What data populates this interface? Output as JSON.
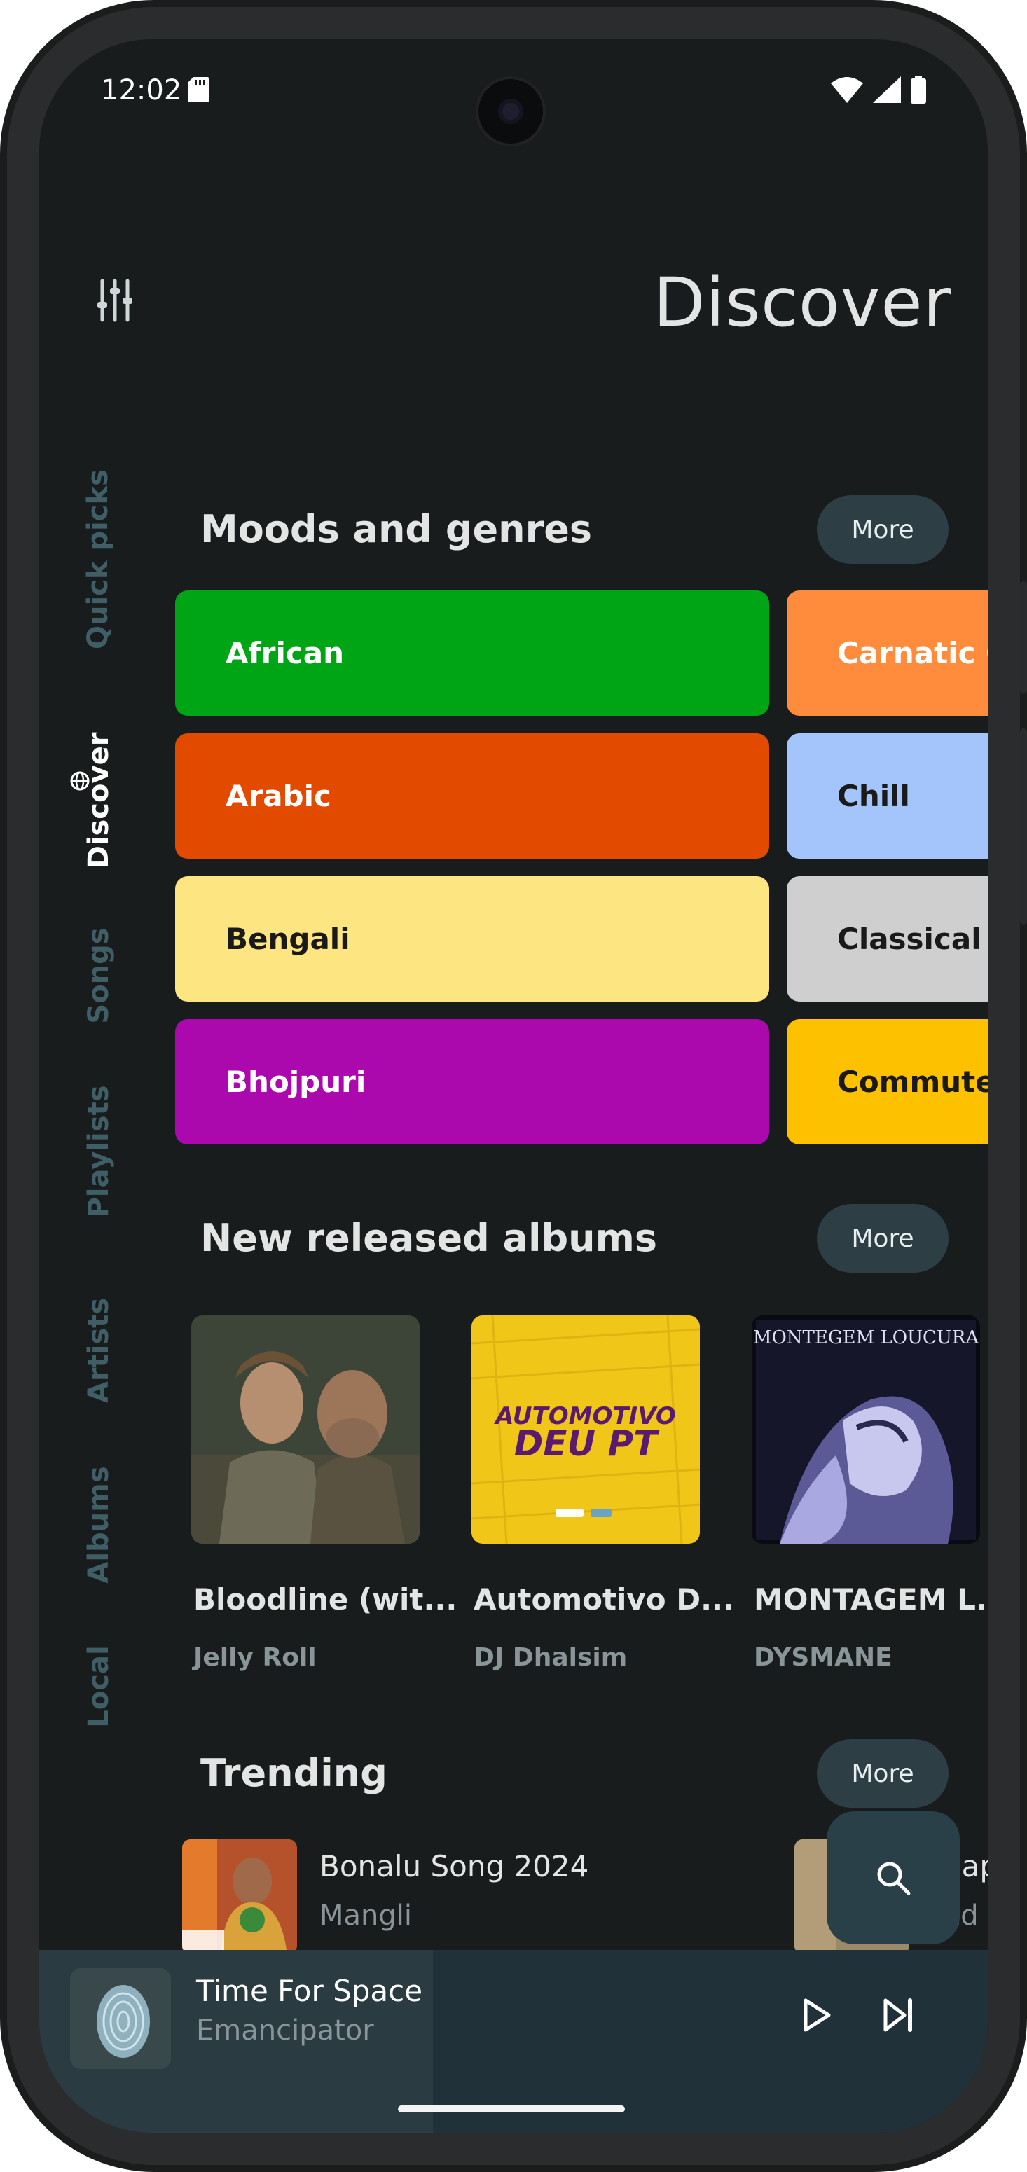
{
  "status": {
    "time": "12:02",
    "icons": [
      "sd-card-icon",
      "wifi-icon",
      "signal-icon",
      "battery-icon"
    ]
  },
  "header": {
    "title": "Discover",
    "settings_icon": "equalizer-icon"
  },
  "nav_rail": {
    "items": [
      {
        "label": "Quick picks",
        "active": false
      },
      {
        "label": "Discover",
        "active": true,
        "icon": "globe-icon"
      },
      {
        "label": "Songs",
        "active": false
      },
      {
        "label": "Playlists",
        "active": false
      },
      {
        "label": "Artists",
        "active": false
      },
      {
        "label": "Albums",
        "active": false
      },
      {
        "label": "Local",
        "active": false
      }
    ]
  },
  "moods": {
    "title": "Moods and genres",
    "more_label": "More",
    "items": [
      {
        "label": "African",
        "color": "#00a516",
        "text_color": "#ffffff"
      },
      {
        "label": "Arabic",
        "color": "#e24a00",
        "text_color": "#ffffff"
      },
      {
        "label": "Bengali",
        "color": "#fde682",
        "text_color": "#1a1a1a"
      },
      {
        "label": "Bhojpuri",
        "color": "#ab08ad",
        "text_color": "#ffffff"
      },
      {
        "label": "Carnatic Classical",
        "color": "#ff8b3d",
        "text_color": "#ffffff"
      },
      {
        "label": "Chill",
        "color": "#a3c5fc",
        "text_color": "#1a1a1a"
      },
      {
        "label": "Classical",
        "color": "#cfcfcf",
        "text_color": "#1a1a1a"
      },
      {
        "label": "Commute",
        "color": "#fec100",
        "text_color": "#1a1a1a"
      }
    ]
  },
  "new_albums": {
    "title": "New released albums",
    "more_label": "More",
    "items": [
      {
        "title": "Bloodline (wit...",
        "artist": "Jelly Roll"
      },
      {
        "title": "Automotivo D...",
        "artist": "DJ Dhalsim",
        "art_text": "AUTOMOTIVO DEU PT"
      },
      {
        "title": "MONTAGEM L...",
        "artist": "DYSMANE",
        "art_text": "MONTEGEM LOUCURA"
      }
    ]
  },
  "trending": {
    "title": "Trending",
    "more_label": "More",
    "items": [
      {
        "title": "Bonalu Song 2024",
        "artist": "Mangli"
      },
      {
        "title": "Sap",
        "artist": "Ed S"
      }
    ]
  },
  "search_icon": "search-icon",
  "now_playing": {
    "title": "Time For Space",
    "artist": "Emancipator",
    "progress": 0.415,
    "controls": [
      "play-icon",
      "skip-next-icon"
    ]
  }
}
